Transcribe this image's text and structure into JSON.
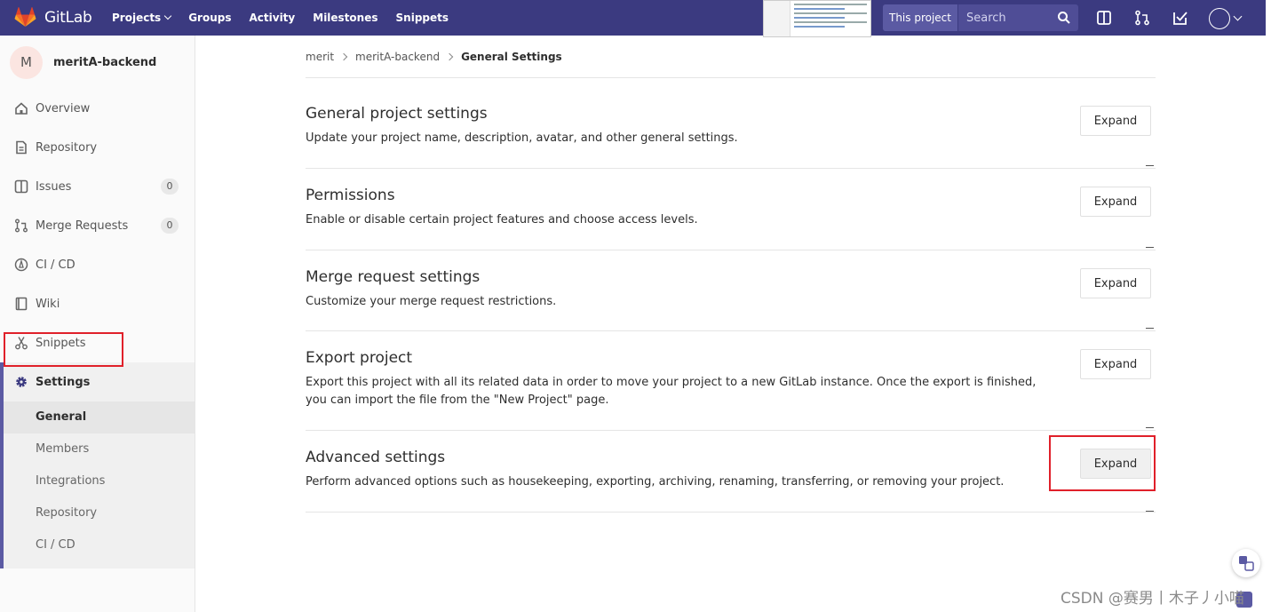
{
  "navbar": {
    "brand": "GitLab",
    "links": [
      {
        "label": "Projects",
        "dropdown": true
      },
      {
        "label": "Groups",
        "dropdown": false
      },
      {
        "label": "Activity",
        "dropdown": false
      },
      {
        "label": "Milestones",
        "dropdown": false
      },
      {
        "label": "Snippets",
        "dropdown": false
      }
    ],
    "search_scope": "This project",
    "search_placeholder": "Search",
    "color": "#3b3a80"
  },
  "sidebar": {
    "project_initial": "M",
    "project_name": "meritA-backend",
    "items": [
      {
        "label": "Overview",
        "icon": "home-icon"
      },
      {
        "label": "Repository",
        "icon": "doc-icon"
      },
      {
        "label": "Issues",
        "icon": "issues-icon",
        "count": "0"
      },
      {
        "label": "Merge Requests",
        "icon": "merge-icon",
        "count": "0"
      },
      {
        "label": "CI / CD",
        "icon": "rocket-icon"
      },
      {
        "label": "Wiki",
        "icon": "book-icon"
      },
      {
        "label": "Snippets",
        "icon": "scissors-icon"
      }
    ],
    "settings": {
      "label": "Settings",
      "icon": "gear-icon",
      "subitems": [
        {
          "label": "General",
          "current": true
        },
        {
          "label": "Members",
          "current": false
        },
        {
          "label": "Integrations",
          "current": false
        },
        {
          "label": "Repository",
          "current": false
        },
        {
          "label": "CI / CD",
          "current": false
        }
      ]
    }
  },
  "breadcrumb": {
    "items": [
      "merit",
      "meritA-backend"
    ],
    "current": "General Settings"
  },
  "sections": [
    {
      "title": "General project settings",
      "desc": "Update your project name, description, avatar, and other general settings.",
      "button": "Expand"
    },
    {
      "title": "Permissions",
      "desc": "Enable or disable certain project features and choose access levels.",
      "button": "Expand"
    },
    {
      "title": "Merge request settings",
      "desc": "Customize your merge request restrictions.",
      "button": "Expand"
    },
    {
      "title": "Export project",
      "desc": "Export this project with all its related data in order to move your project to a new GitLab instance. Once the export is finished, you can import the file from the \"New Project\" page.",
      "button": "Expand"
    },
    {
      "title": "Advanced settings",
      "desc": "Perform advanced options such as housekeeping, exporting, archiving, renaming, transferring, or removing your project.",
      "button": "Expand"
    }
  ],
  "watermark": "CSDN @赛男丨木子丿小喵"
}
